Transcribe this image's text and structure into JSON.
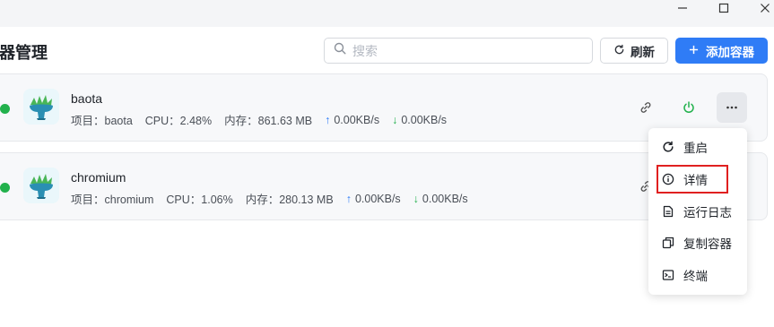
{
  "header": {
    "title": "器管理",
    "search_placeholder": "搜索",
    "refresh_label": "刷新",
    "add_label": "添加容器"
  },
  "containers": [
    {
      "name": "baota",
      "project_label": "项目：baota",
      "cpu_label": "CPU：2.48%",
      "mem_label": "内存：861.63 MB",
      "up_label": "0.00KB/s",
      "down_label": "0.00KB/s",
      "status_color": "#22b14c"
    },
    {
      "name": "chromium",
      "project_label": "项目：chromium",
      "cpu_label": "CPU：1.06%",
      "mem_label": "内存：280.13 MB",
      "up_label": "0.00KB/s",
      "down_label": "0.00KB/s",
      "status_color": "#22b14c"
    }
  ],
  "menu": {
    "items": [
      {
        "label": "重启",
        "icon": "restart-icon"
      },
      {
        "label": "详情",
        "icon": "info-icon",
        "highlighted": true
      },
      {
        "label": "运行日志",
        "icon": "log-file-icon"
      },
      {
        "label": "复制容器",
        "icon": "copy-icon"
      },
      {
        "label": "终端",
        "icon": "terminal-icon"
      }
    ]
  },
  "colors": {
    "accent": "#2f7cf6",
    "running": "#22b14c",
    "highlight_border": "#e02020"
  }
}
